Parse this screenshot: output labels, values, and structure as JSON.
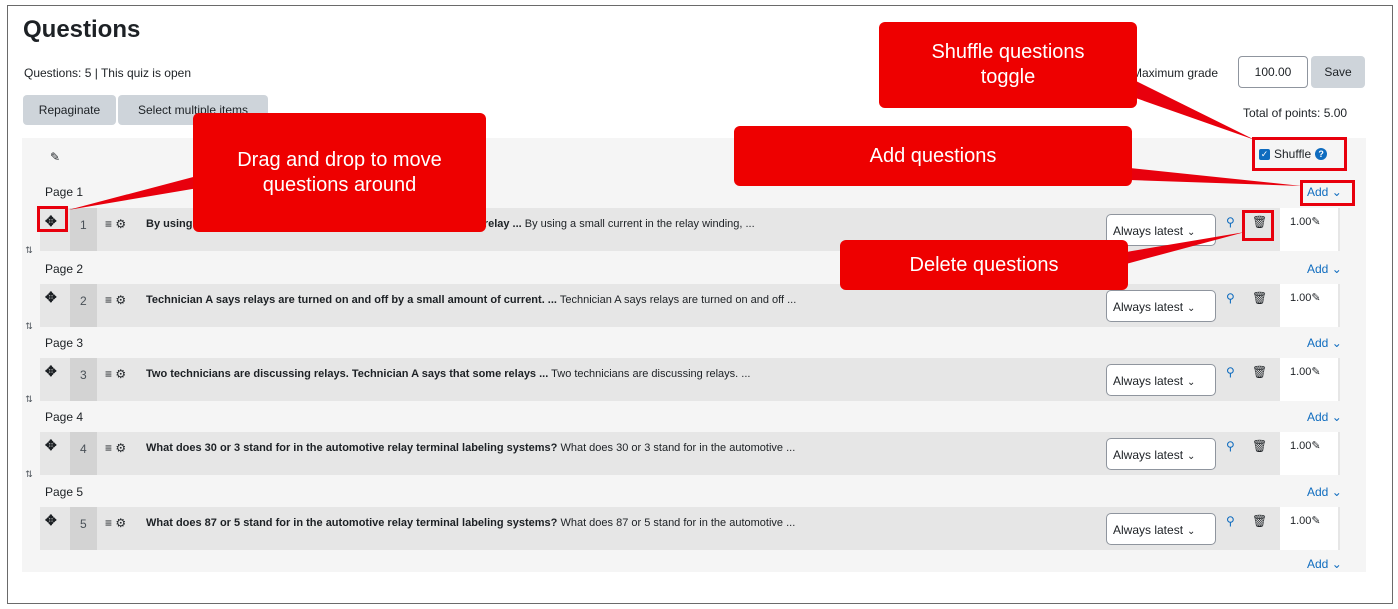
{
  "header": {
    "title": "Questions",
    "status": "Questions: 5 | This quiz is open",
    "repaginate_label": "Repaginate",
    "select_multiple_label": "Select multiple items",
    "max_grade_label": "Maximum grade",
    "max_grade_value": "100.00",
    "save_label": "Save",
    "total_points": "Total of points: 5.00",
    "shuffle_label": "Shuffle"
  },
  "add_label": "Add",
  "pages": [
    {
      "label": "Page 1",
      "question": {
        "number": "1",
        "bold": "By using",
        "bold_tail": "cts in the relay ...",
        "preview": "By using a small current in the relay winding, ...",
        "version": "Always latest",
        "mark": "1.00"
      }
    },
    {
      "label": "Page 2",
      "question": {
        "number": "2",
        "bold": "Technician A says relays are turned on and off by a small amount of current. ...",
        "bold_tail": "",
        "preview": "Technician A says relays are turned on and off ...",
        "version": "Always latest",
        "mark": "1.00"
      }
    },
    {
      "label": "Page 3",
      "question": {
        "number": "3",
        "bold": "Two technicians are discussing relays. Technician A says that some relays ...",
        "bold_tail": "",
        "preview": "Two technicians are discussing relays. ...",
        "version": "Always latest",
        "mark": "1.00"
      }
    },
    {
      "label": "Page 4",
      "question": {
        "number": "4",
        "bold": "What does 30 or 3 stand for in the automotive relay terminal labeling systems?",
        "bold_tail": "",
        "preview": "What does 30 or 3 stand for in the automotive ...",
        "version": "Always latest",
        "mark": "1.00"
      }
    },
    {
      "label": "Page 5",
      "question": {
        "number": "5",
        "bold": "What does 87 or 5 stand for in the automotive relay terminal labeling systems?",
        "bold_tail": "",
        "preview": "What does 87 or 5 stand for in the automotive ...",
        "version": "Always latest",
        "mark": "1.00"
      }
    }
  ],
  "callouts": {
    "drag": "Drag and drop to move questions around",
    "shuffle": "Shuffle questions toggle",
    "add": "Add questions",
    "delete": "Delete questions"
  },
  "colors": {
    "callout": "#ee0000",
    "link": "#0f6cbf",
    "button": "#ced4da"
  }
}
